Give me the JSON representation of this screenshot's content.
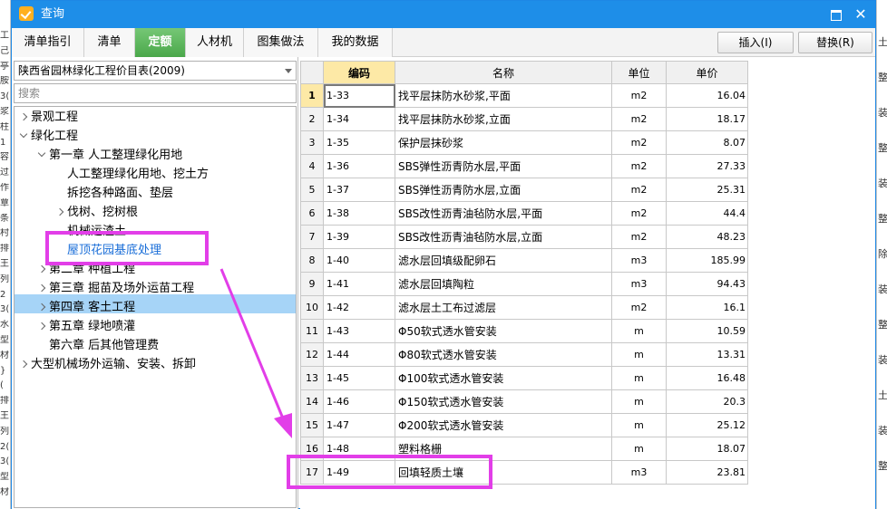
{
  "window": {
    "title": "查询",
    "maximize_symbol": "",
    "close_symbol": "✕"
  },
  "tabs": [
    {
      "label": "清单指引"
    },
    {
      "label": "清单"
    },
    {
      "label": "定额",
      "active": true
    },
    {
      "label": "人材机"
    },
    {
      "label": "图集做法"
    },
    {
      "label": "我的数据"
    }
  ],
  "toolbar": {
    "insert_label": "插入(I)",
    "replace_label": "替换(R)"
  },
  "catalog": {
    "selected": "陕西省园林绿化工程价目表(2009)"
  },
  "search": {
    "placeholder": "搜索",
    "value": ""
  },
  "tree": [
    {
      "label": "景观工程",
      "depth": 0,
      "state": "collapsed"
    },
    {
      "label": "绿化工程",
      "depth": 0,
      "state": "expanded"
    },
    {
      "label": "第一章 人工整理绿化用地",
      "depth": 1,
      "state": "expanded"
    },
    {
      "label": "人工整理绿化用地、挖土方",
      "depth": 2,
      "state": "leaf"
    },
    {
      "label": "拆挖各种路面、垫层",
      "depth": 2,
      "state": "leaf"
    },
    {
      "label": "伐树、挖树根",
      "depth": 2,
      "state": "collapsed"
    },
    {
      "label": "机械运渣土",
      "depth": 2,
      "state": "leaf"
    },
    {
      "label": "屋顶花园基底处理",
      "depth": 2,
      "state": "leaf",
      "selected": true
    },
    {
      "label": "第二章 种植工程",
      "depth": 1,
      "state": "collapsed"
    },
    {
      "label": "第三章 掘苗及场外运苗工程",
      "depth": 1,
      "state": "collapsed"
    },
    {
      "label": "第四章 客土工程",
      "depth": 1,
      "state": "collapsed"
    },
    {
      "label": "第五章 绿地喷灌",
      "depth": 1,
      "state": "collapsed"
    },
    {
      "label": "第六章 后其他管理费",
      "depth": 1,
      "state": "leaf"
    },
    {
      "label": "大型机械场外运输、安装、拆卸",
      "depth": 0,
      "state": "collapsed"
    }
  ],
  "grid": {
    "headers": {
      "code": "编码",
      "name": "名称",
      "unit": "单位",
      "price": "单价"
    },
    "rows": [
      {
        "n": "1",
        "code": "1-33",
        "name": "找平层抹防水砂浆,平面",
        "unit": "m2",
        "price": "16.04"
      },
      {
        "n": "2",
        "code": "1-34",
        "name": "找平层抹防水砂浆,立面",
        "unit": "m2",
        "price": "18.17"
      },
      {
        "n": "3",
        "code": "1-35",
        "name": "保护层抹砂浆",
        "unit": "m2",
        "price": "8.07"
      },
      {
        "n": "4",
        "code": "1-36",
        "name": "SBS弹性沥青防水层,平面",
        "unit": "m2",
        "price": "27.33"
      },
      {
        "n": "5",
        "code": "1-37",
        "name": "SBS弹性沥青防水层,立面",
        "unit": "m2",
        "price": "25.31"
      },
      {
        "n": "6",
        "code": "1-38",
        "name": "SBS改性沥青油毡防水层,平面",
        "unit": "m2",
        "price": "44.4"
      },
      {
        "n": "7",
        "code": "1-39",
        "name": "SBS改性沥青油毡防水层,立面",
        "unit": "m2",
        "price": "48.23"
      },
      {
        "n": "8",
        "code": "1-40",
        "name": "滤水层回填级配卵石",
        "unit": "m3",
        "price": "185.99"
      },
      {
        "n": "9",
        "code": "1-41",
        "name": "滤水层回填陶粒",
        "unit": "m3",
        "price": "94.43"
      },
      {
        "n": "10",
        "code": "1-42",
        "name": "滤水层土工布过滤层",
        "unit": "m2",
        "price": "16.1"
      },
      {
        "n": "11",
        "code": "1-43",
        "name": "Φ50软式透水管安装",
        "unit": "m",
        "price": "10.59"
      },
      {
        "n": "12",
        "code": "1-44",
        "name": "Φ80软式透水管安装",
        "unit": "m",
        "price": "13.31"
      },
      {
        "n": "13",
        "code": "1-45",
        "name": "Φ100软式透水管安装",
        "unit": "m",
        "price": "16.48"
      },
      {
        "n": "14",
        "code": "1-46",
        "name": "Φ150软式透水管安装",
        "unit": "m",
        "price": "20.3"
      },
      {
        "n": "15",
        "code": "1-47",
        "name": "Φ200软式透水管安装",
        "unit": "m",
        "price": "25.12"
      },
      {
        "n": "16",
        "code": "1-48",
        "name": "塑料格栅",
        "unit": "m",
        "price": "18.07"
      },
      {
        "n": "17",
        "code": "1-49",
        "name": "回填轻质土壤",
        "unit": "m3",
        "price": "23.81"
      }
    ]
  },
  "background": {
    "left_fragments": [
      "工",
      "己",
      "亭",
      "胺",
      "3(",
      "浆",
      "柱",
      "1",
      "容",
      "过",
      "作",
      "覃",
      "条",
      "村",
      "排",
      "王",
      "列",
      "2",
      "3(",
      "水",
      "型",
      "材",
      "}",
      "(",
      "排",
      "王",
      "列",
      "2(",
      "3(",
      "型",
      "材"
    ],
    "right_fragments": [
      "土",
      "整",
      "装",
      "整",
      "装",
      "整",
      "除",
      "装",
      "整",
      "装",
      "土",
      "装",
      "整"
    ]
  },
  "colors": {
    "titlebar": "#1e8ee8",
    "active_tab": "#5cb85c",
    "selection": "#a6d4f7",
    "annotation": "#e23ee8",
    "sorted_header": "#fde9a6"
  }
}
